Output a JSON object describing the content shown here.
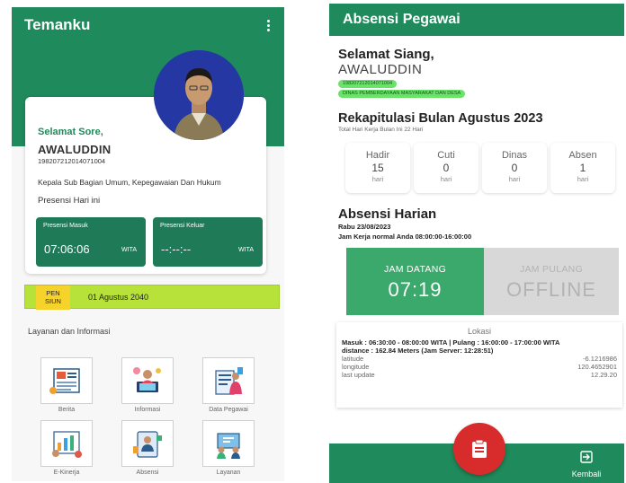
{
  "left": {
    "app_title": "Temanku",
    "greeting": "Selamat Sore,",
    "name": "AWALUDDIN",
    "nip": "198207212014071004",
    "position": "Kepala Sub Bagian Umum, Kepegawaian Dan Hukum",
    "presensi_label": "Presensi Hari ini",
    "masuk": {
      "label": "Presensi Masuk",
      "time": "07:06:06",
      "tz": "WITA"
    },
    "keluar": {
      "label": "Presensi Keluar",
      "time": "--:--:--",
      "tz": "WITA"
    },
    "pension": {
      "badge_line1": "PEN",
      "badge_line2": "SIUN",
      "date": "01 Agustus 2040"
    },
    "layanan_label": "Layanan dan Informasi",
    "menu": [
      {
        "label": "Berita",
        "icon": "news-icon"
      },
      {
        "label": "Informasi",
        "icon": "info-icon"
      },
      {
        "label": "Data Pegawai",
        "icon": "employee-data-icon"
      },
      {
        "label": "E-Kinerja",
        "icon": "performance-icon"
      },
      {
        "label": "Absensi",
        "icon": "attendance-icon"
      },
      {
        "label": "Layanan",
        "icon": "service-icon"
      }
    ]
  },
  "right": {
    "app_title": "Absensi Pegawai",
    "greeting": "Selamat Siang,",
    "name": "AWALUDDIN",
    "nip_chip": "198207212014071004",
    "dept_chip": "DINAS PEMBERDAYAAN MASYARAKAT DAN DESA",
    "rekap_title": "Rekapitulasi Bulan Agustus 2023",
    "rekap_sub": "Total Hari Kerja Bulan Ini 22 Hari",
    "stats": [
      {
        "label": "Hadir",
        "value": "15",
        "unit": "hari"
      },
      {
        "label": "Cuti",
        "value": "0",
        "unit": "hari"
      },
      {
        "label": "Dinas",
        "value": "0",
        "unit": "hari"
      },
      {
        "label": "Absen",
        "value": "1",
        "unit": "hari"
      }
    ],
    "harian_title": "Absensi Harian",
    "harian_date": "Rabu 23/08/2023",
    "harian_jam": "Jam Kerja normal Anda 08:00:00-16:00:00",
    "jam_datang": {
      "label": "JAM DATANG",
      "value": "07:19"
    },
    "jam_pulang": {
      "label": "JAM PULANG",
      "value": "OFFLINE"
    },
    "lokasi": {
      "title": "Lokasi",
      "schedule": "Masuk : 06:30:00 - 08:00:00 WITA | Pulang : 16:00:00 - 17:00:00 WITA",
      "distance": "distance : 162.84 Meters (Jam Server: 12:28:51)",
      "rows": [
        {
          "key": "latitude",
          "value": "-6.1216986"
        },
        {
          "key": "longitude",
          "value": "120.4652901"
        },
        {
          "key": "last update",
          "value": "12.29.20"
        }
      ]
    },
    "kembali_label": "Kembali"
  },
  "colors": {
    "primary": "#1f8a5b",
    "accent_green": "#3ba86c",
    "fab_red": "#d82c2c",
    "pension_bar": "#b7e23a",
    "pension_badge": "#f5d32a"
  }
}
